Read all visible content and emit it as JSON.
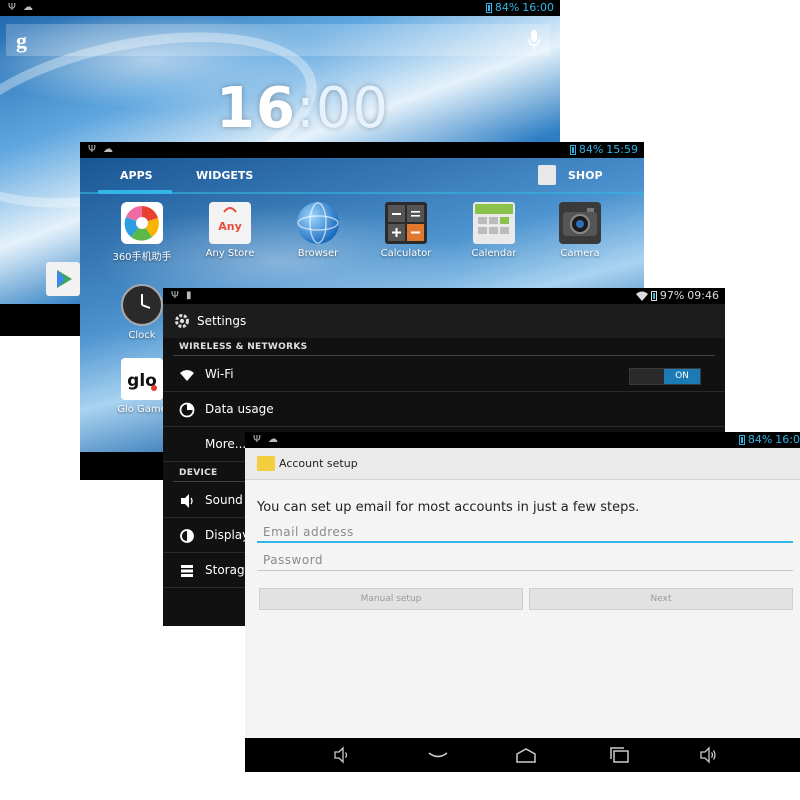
{
  "home": {
    "status_time": "16:00",
    "battery": "84%",
    "clock": {
      "hours": "16",
      "minutes": ":00"
    },
    "search_icon": "google-g-icon",
    "mic_icon": "mic-icon"
  },
  "drawer": {
    "status_time": "15:59",
    "battery": "84%",
    "tabs": {
      "apps": "APPS",
      "widgets": "WIDGETS",
      "shop": "SHOP"
    },
    "apps": [
      {
        "label": "360手机助手",
        "icon": "360-assistant-icon"
      },
      {
        "label": "Any Store",
        "icon": "any-store-icon"
      },
      {
        "label": "Browser",
        "icon": "globe-icon"
      },
      {
        "label": "Calculator",
        "icon": "calculator-icon"
      },
      {
        "label": "Calendar",
        "icon": "calendar-icon"
      },
      {
        "label": "Camera",
        "icon": "camera-icon"
      },
      {
        "label": "Clock",
        "icon": "clock-icon"
      },
      {
        "label": "Glo Game",
        "icon": "glo-game-icon"
      }
    ],
    "any_store_badge": "Any",
    "glo_badge": "glo"
  },
  "settings": {
    "status_time": "09:46",
    "battery": "97%",
    "title": "Settings",
    "sections": {
      "wireless": "WIRELESS & NETWORKS",
      "device": "DEVICE"
    },
    "items": {
      "wifi": "Wi-Fi",
      "wifi_toggle": "ON",
      "data_usage": "Data usage",
      "more": "More...",
      "sound": "Sound",
      "display": "Display",
      "storage": "Storage"
    }
  },
  "account": {
    "status_time": "16:0",
    "battery": "84%",
    "title": "Account setup",
    "instruction": "You can set up email for most accounts in just a few steps.",
    "email_placeholder": "Email address",
    "password_placeholder": "Password",
    "manual_setup": "Manual setup",
    "next": "Next"
  },
  "colors": {
    "accent": "#33b5e5",
    "toggle_on": "#1c7bb4"
  }
}
